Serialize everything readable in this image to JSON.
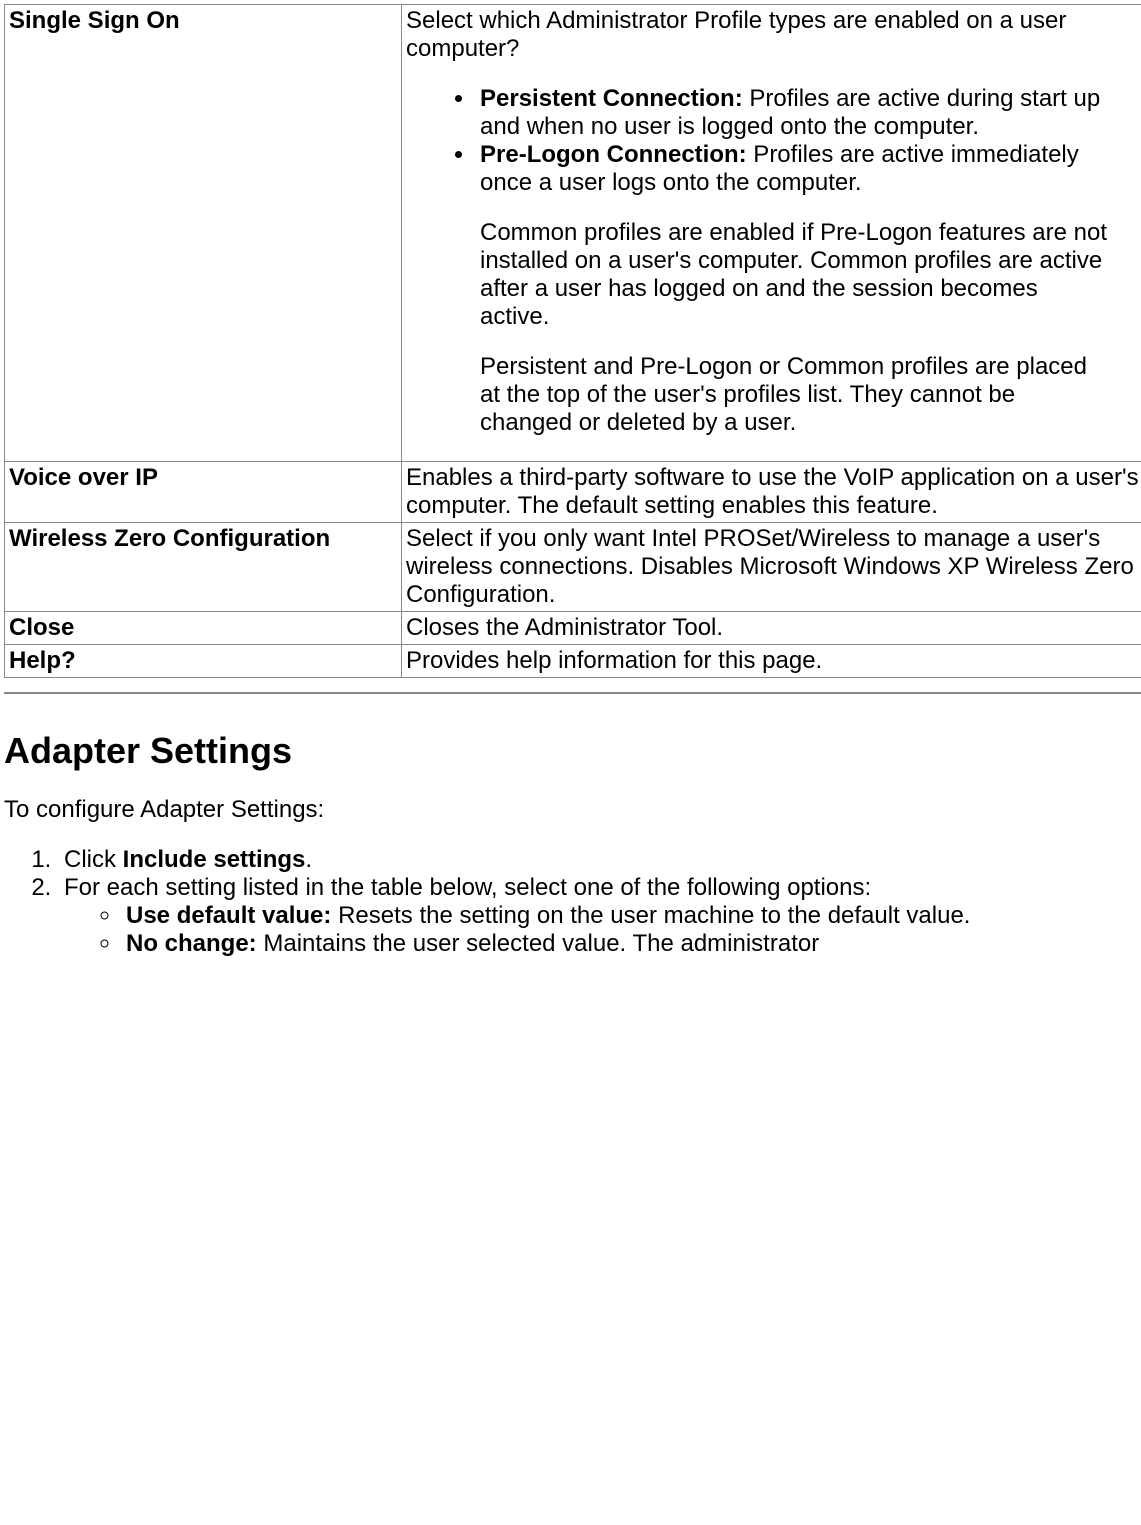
{
  "rows": {
    "sso": {
      "label": "Single Sign On",
      "intro": "Select which Administrator Profile types are enabled on a user computer?",
      "bullets": {
        "persistent": {
          "term": "Persistent Connection:",
          "text": " Profiles are active during start up and when no user is logged onto the computer."
        },
        "prelogon": {
          "term": "Pre-Logon Connection:",
          "text": " Profiles are active immediately once a user logs onto the computer."
        }
      },
      "para1": "Common profiles are enabled if Pre-Logon features are not installed on a user's computer. Common profiles are active after a user has logged on and the session becomes active.",
      "para2": "Persistent and Pre-Logon or Common profiles are placed at the top of the user's profiles list. They cannot be changed or deleted by a user."
    },
    "voip": {
      "label": "Voice over IP",
      "desc": "Enables a third-party software to use the VoIP application on a user's computer. The default setting enables this feature."
    },
    "wzc": {
      "label": "Wireless Zero Configuration",
      "desc": "Select if you only want Intel PROSet/Wireless to manage a user's wireless connections. Disables Microsoft Windows XP Wireless Zero Configuration."
    },
    "close": {
      "label": "Close",
      "desc": "Closes the Administrator Tool."
    },
    "help": {
      "label": "Help?",
      "desc": "Provides help information for this page."
    }
  },
  "section": {
    "heading": "Adapter Settings",
    "intro": "To configure Adapter Settings:",
    "step1": {
      "pre": "Click ",
      "bold": "Include settings",
      "post": "."
    },
    "step2": {
      "text": "For each setting listed in the table below, select one of the following options:",
      "opts": {
        "default": {
          "term": "Use default value:",
          "text": " Resets the setting on the user machine to the default value."
        },
        "nochange": {
          "term": "No change:",
          "text": " Maintains the user selected value. The administrator"
        }
      }
    }
  }
}
